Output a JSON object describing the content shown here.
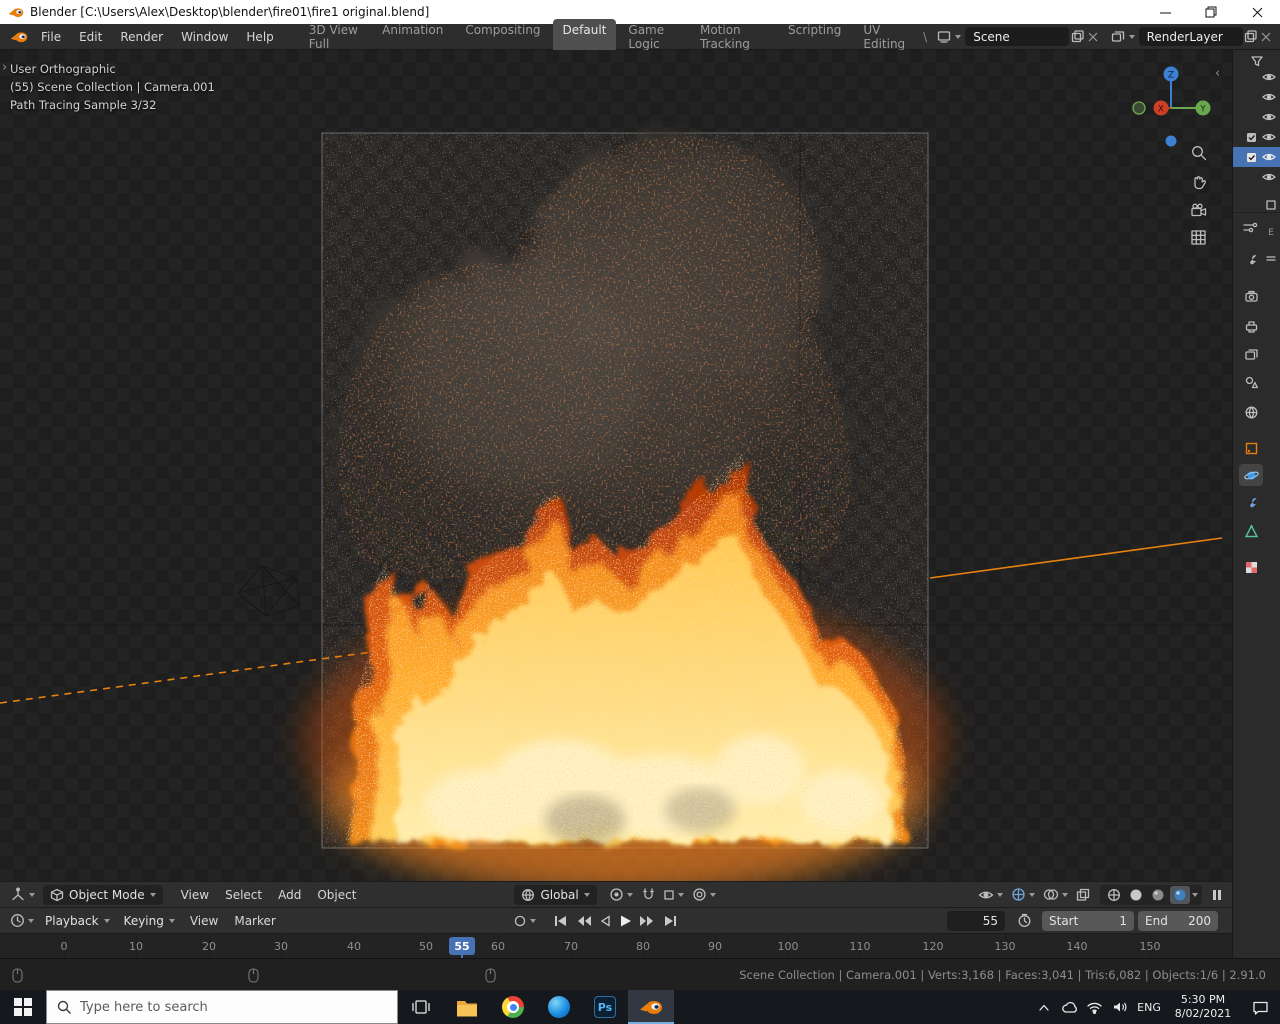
{
  "window": {
    "title": "Blender [C:\\Users\\Alex\\Desktop\\blender\\fire01\\fire1 original.blend]"
  },
  "topbar": {
    "menus": [
      "File",
      "Edit",
      "Render",
      "Window",
      "Help"
    ],
    "workspaces": [
      "3D View Full",
      "Animation",
      "Compositing",
      "Default",
      "Game Logic",
      "Motion Tracking",
      "Scripting",
      "UV Editing"
    ],
    "active_workspace": "Default",
    "separator": "\\",
    "scene_field": {
      "value": "Scene"
    },
    "render_layer_field": {
      "value": "RenderLayer"
    }
  },
  "viewport": {
    "overlay": {
      "line1": "User Orthographic",
      "line2": "(55) Scene Collection | Camera.001",
      "line3": "Path Tracing Sample 3/32"
    },
    "gizmo_axes": {
      "x": "X",
      "y": "Y",
      "z": "Z"
    },
    "header": {
      "mode": "Object Mode",
      "menus": [
        "View",
        "Select",
        "Add",
        "Object"
      ],
      "orientation": "Global"
    }
  },
  "timeline": {
    "playback": "Playback",
    "keying": "Keying",
    "menus": [
      "View",
      "Marker"
    ],
    "current_frame": "55",
    "playhead": "55",
    "start_label": "Start",
    "start_value": "1",
    "end_label": "End",
    "end_value": "200",
    "ticks": [
      "0",
      "10",
      "20",
      "30",
      "40",
      "50",
      "60",
      "70",
      "80",
      "90",
      "100",
      "110",
      "120",
      "130",
      "140",
      "150"
    ]
  },
  "statusbar": {
    "info": "Scene Collection | Camera.001 | Verts:3,168 | Faces:3,041 | Tris:6,082 | Objects:1/6 | 2.91.0"
  },
  "taskbar": {
    "search_placeholder": "Type here to search",
    "photoshop_label": "Ps",
    "language": "ENG",
    "time": "5:30 PM",
    "date": "8/02/2021"
  },
  "colors": {
    "accent_blue": "#4772b3",
    "blender_orange": "#e87d0d",
    "fire_outer": "#e2580c",
    "fire_mid": "#ffb93e",
    "fire_core": "#fff3c0",
    "smoke": "#46403a"
  }
}
